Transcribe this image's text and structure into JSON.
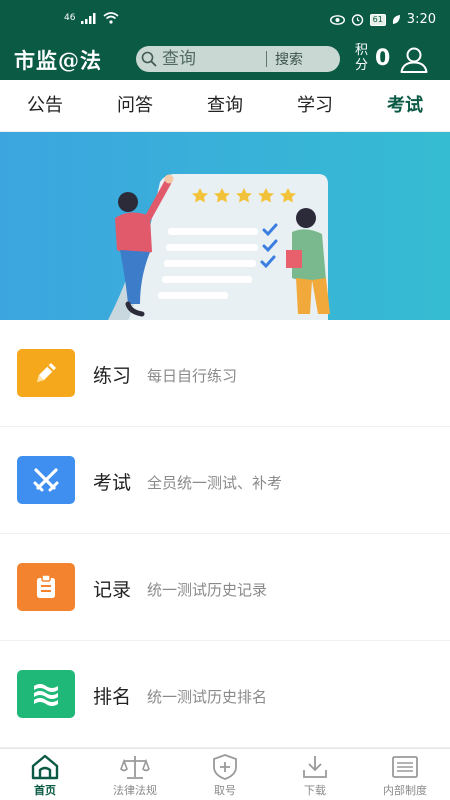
{
  "status_bar": {
    "network": "46",
    "battery": "61",
    "time": "3:20"
  },
  "header": {
    "brand": "市监@法",
    "search_placeholder": "查询",
    "search_button": "搜索",
    "points_label": "积分",
    "points_value": "0"
  },
  "tabs": [
    {
      "label": "公告",
      "active": false
    },
    {
      "label": "问答",
      "active": false
    },
    {
      "label": "查询",
      "active": false
    },
    {
      "label": "学习",
      "active": false
    },
    {
      "label": "考试",
      "active": true
    }
  ],
  "menu": [
    {
      "title": "练习",
      "desc": "每日自行练习",
      "icon": "pencil-icon",
      "color": "#f5a81c"
    },
    {
      "title": "考试",
      "desc": "全员统一测试、补考",
      "icon": "crossed-swords-icon",
      "color": "#3f8ff0"
    },
    {
      "title": "记录",
      "desc": "统一测试历史记录",
      "icon": "clipboard-icon",
      "color": "#f3832e"
    },
    {
      "title": "排名",
      "desc": "统一测试历史排名",
      "icon": "layers-icon",
      "color": "#20b878"
    }
  ],
  "bottom_nav": [
    {
      "label": "首页",
      "icon": "home-icon",
      "active": true
    },
    {
      "label": "法律法规",
      "icon": "scales-icon",
      "active": false
    },
    {
      "label": "取号",
      "icon": "shield-plus-icon",
      "active": false
    },
    {
      "label": "下载",
      "icon": "download-icon",
      "active": false
    },
    {
      "label": "内部制度",
      "icon": "document-list-icon",
      "active": false
    }
  ],
  "colors": {
    "primary": "#0b5a44",
    "banner": "#36b6d8"
  }
}
